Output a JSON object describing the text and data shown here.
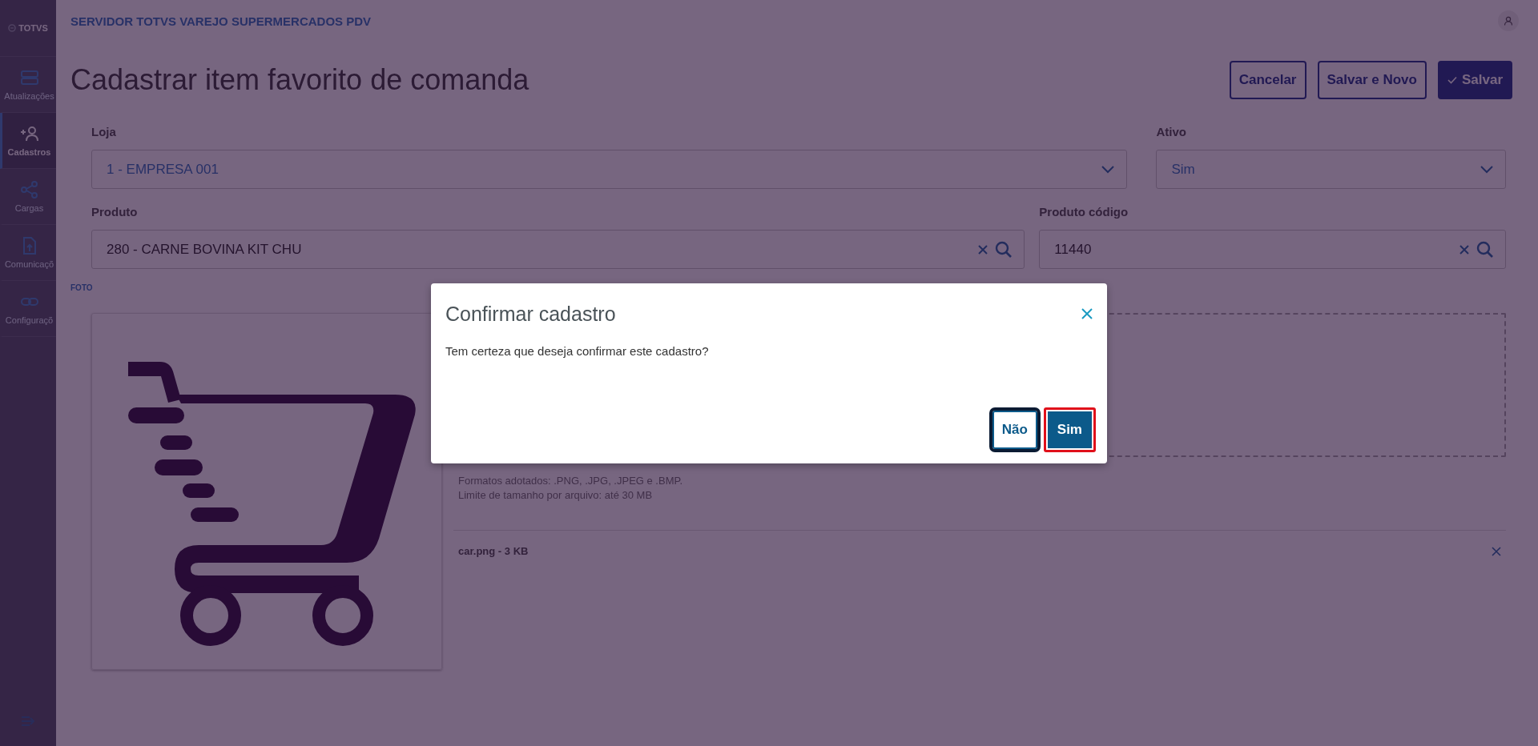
{
  "logo": "TOTVS",
  "sidebar": {
    "items": [
      {
        "label": "Atualizações",
        "selected": false
      },
      {
        "label": "Cadastros",
        "selected": true
      },
      {
        "label": "Cargas",
        "selected": false
      },
      {
        "label": "Comunicaçõ",
        "selected": false
      },
      {
        "label": "Configuraçõ",
        "selected": false
      }
    ]
  },
  "header": {
    "title": "SERVIDOR TOTVS VAREJO SUPERMERCADOS PDV"
  },
  "page": {
    "title": "Cadastrar item favorito de comanda",
    "actions": [
      {
        "label": "Cancelar",
        "kind": "secondary"
      },
      {
        "label": "Salvar e Novo",
        "kind": "secondary"
      },
      {
        "label": "Salvar",
        "kind": "primary"
      }
    ]
  },
  "form": {
    "rows": [
      [
        {
          "label": "Loja",
          "value": "1 - EMPRESA 001",
          "kind": "select"
        },
        {
          "label": "Ativo",
          "value": "Sim",
          "kind": "select"
        }
      ],
      [
        {
          "label": "Produto",
          "value": "280 - CARNE BOVINA KIT CHU",
          "kind": "lookup"
        },
        {
          "label": "Produto código",
          "value": "11440",
          "kind": "lookup"
        }
      ]
    ]
  },
  "photo": {
    "label": "FOTO",
    "hints": [
      "Formatos adotados: .PNG, .JPG, .JPEG e .BMP.",
      "Limite de tamanho por arquivo: até 30 MB"
    ],
    "file": "car.png - 3 KB"
  },
  "dialog": {
    "title": "Confirmar cadastro",
    "message": "Tem certeza que deseja confirmar este cadastro?",
    "buttons": [
      {
        "label": "Não",
        "kind": "secondary",
        "focused": true,
        "highlighted": false
      },
      {
        "label": "Sim",
        "kind": "primary",
        "focused": false,
        "highlighted": true
      }
    ]
  }
}
